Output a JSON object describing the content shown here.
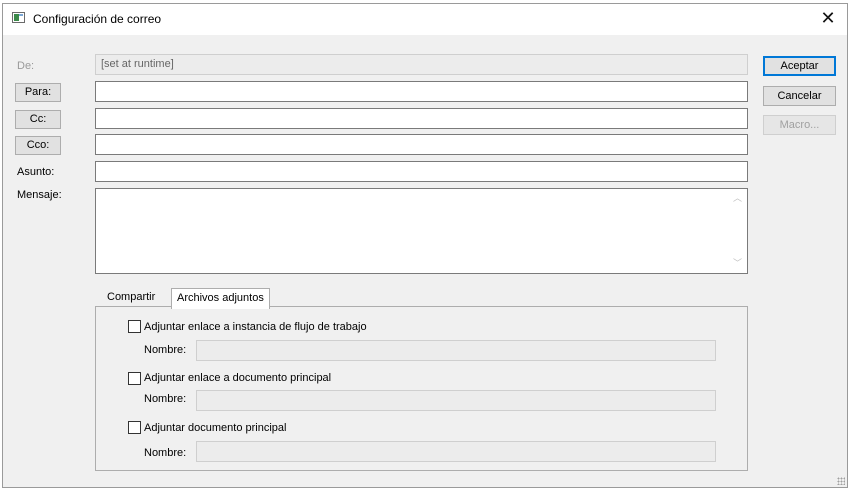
{
  "window": {
    "title": "Configuración de correo"
  },
  "form": {
    "from_label": "De:",
    "from_value": "[set at runtime]",
    "to_button": "Para:",
    "cc_button": "Cc:",
    "bcc_button": "Cco:",
    "subject_label": "Asunto:",
    "message_label": "Mensaje:",
    "to_value": "",
    "cc_value": "",
    "bcc_value": "",
    "subject_value": "",
    "message_value": ""
  },
  "actions": {
    "ok": "Aceptar",
    "cancel": "Cancelar",
    "macro": "Macro..."
  },
  "tabs": [
    {
      "label": "Compartir",
      "active": false
    },
    {
      "label": "Archivos adjuntos",
      "active": true
    }
  ],
  "attachments": [
    {
      "label": "Adjuntar enlace a instancia de flujo de trabajo",
      "checked": false,
      "name_label": "Nombre:",
      "name_value": ""
    },
    {
      "label": "Adjuntar enlace a documento principal",
      "checked": false,
      "name_label": "Nombre:",
      "name_value": ""
    },
    {
      "label": "Adjuntar documento principal",
      "checked": false,
      "name_label": "Nombre:",
      "name_value": ""
    }
  ],
  "icons": {
    "app": "mail-config-window-icon",
    "close": "close-icon",
    "scroll_up": "chevron-up-icon",
    "scroll_down": "chevron-down-icon"
  },
  "colors": {
    "dialog_bg": "#f0f0f0",
    "accent": "#0078d7"
  }
}
